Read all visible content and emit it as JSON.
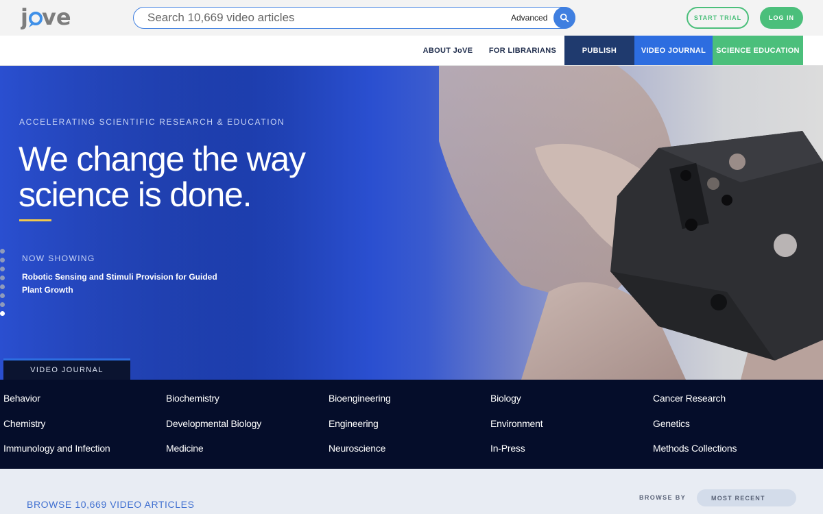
{
  "header": {
    "logo_text": "jove",
    "search": {
      "placeholder": "Search 10,669 video articles",
      "advanced_label": "Advanced"
    },
    "start_trial_label": "START TRIAL",
    "login_label": "LOG IN"
  },
  "nav": {
    "about": "ABOUT JoVE",
    "librarians": "FOR LIBRARIANS",
    "publish": "PUBLISH",
    "video_journal": "VIDEO JOURNAL",
    "science_education": "SCIENCE EDUCATION"
  },
  "hero": {
    "eyebrow": "ACCELERATING SCIENTIFIC RESEARCH & EDUCATION",
    "title": "We change the way science is done.",
    "now_showing_label": "NOW SHOWING",
    "now_showing_title": "Robotic Sensing and Stimuli Provision for Guided Plant Growth",
    "slide_count": 8,
    "active_slide": 7,
    "tab_label": "VIDEO JOURNAL"
  },
  "categories": [
    "Behavior",
    "Biochemistry",
    "Bioengineering",
    "Biology",
    "Cancer Research",
    "Chemistry",
    "Developmental Biology",
    "Engineering",
    "Environment",
    "Genetics",
    "Immunology and Infection",
    "Medicine",
    "Neuroscience",
    "In-Press",
    "Methods Collections"
  ],
  "browse": {
    "title": "BROWSE 10,669 VIDEO ARTICLES",
    "browse_by_label": "BROWSE BY",
    "sort_value": "MOST RECENT"
  },
  "colors": {
    "brand_blue": "#2d6de0",
    "brand_green": "#4bbf7b",
    "navy": "#1f3a6e",
    "accent_yellow": "#f2c94c"
  }
}
